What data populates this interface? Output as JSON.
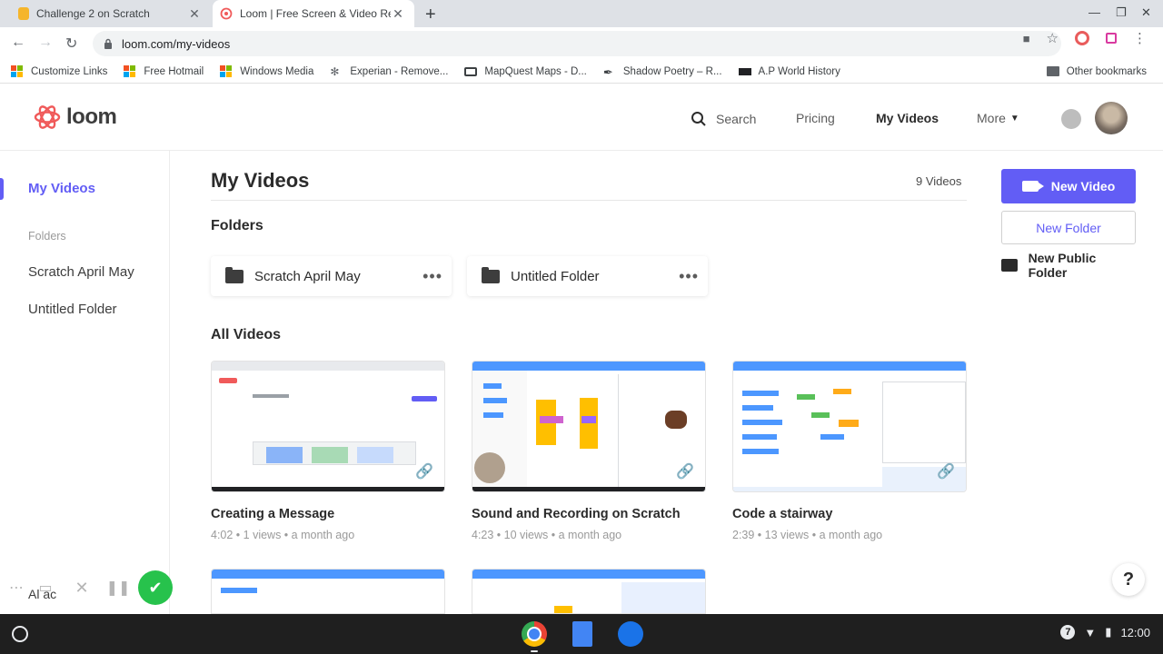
{
  "browser": {
    "tabs": [
      {
        "title": "Challenge 2 on Scratch",
        "active": false
      },
      {
        "title": "Loom | Free Screen & Video Recording",
        "active": true
      }
    ],
    "url": "loom.com/my-videos",
    "bookmarks": [
      {
        "label": "Customize Links",
        "icon": "ms-icon"
      },
      {
        "label": "Free Hotmail",
        "icon": "ms-icon"
      },
      {
        "label": "Windows Media",
        "icon": "ms-icon"
      },
      {
        "label": "Experian - Remove...",
        "icon": "experian-icon"
      },
      {
        "label": "MapQuest Maps - D...",
        "icon": "mapquest-icon"
      },
      {
        "label": "Shadow Poetry – R...",
        "icon": "quill-icon"
      },
      {
        "label": "A.P World History",
        "icon": "bbc-icon"
      }
    ],
    "other_bookmarks": "Other bookmarks"
  },
  "header": {
    "logo_text": "loom",
    "nav": {
      "search": "Search",
      "pricing": "Pricing",
      "my_videos": "My Videos",
      "more": "More"
    }
  },
  "sidebar": {
    "my_videos": "My Videos",
    "folders_label": "Folders",
    "folders": [
      "Scratch April May",
      "Untitled Folder"
    ]
  },
  "main": {
    "title": "My Videos",
    "video_count": "9 Videos",
    "folders_heading": "Folders",
    "folders": [
      {
        "name": "Scratch April May"
      },
      {
        "name": "Untitled Folder"
      }
    ],
    "all_videos_heading": "All Videos",
    "videos": [
      {
        "title": "Creating a Message",
        "meta": "4:02 • 1 views • a month ago"
      },
      {
        "title": "Sound and Recording on Scratch",
        "meta": "4:23 • 10 views • a month ago"
      },
      {
        "title": "Code a stairway",
        "meta": "2:39 • 13 views • a month ago"
      }
    ]
  },
  "actions": {
    "new_video": "New Video",
    "new_folder": "New Folder",
    "new_public_folder": "New Public Folder"
  },
  "help": "?",
  "ghost_text": "Al   ac",
  "shelf": {
    "clock": "12:00",
    "notification_count": "7"
  },
  "colors": {
    "accent": "#625df5",
    "loom_red": "#f05a5a",
    "check_green": "#27c24c"
  }
}
